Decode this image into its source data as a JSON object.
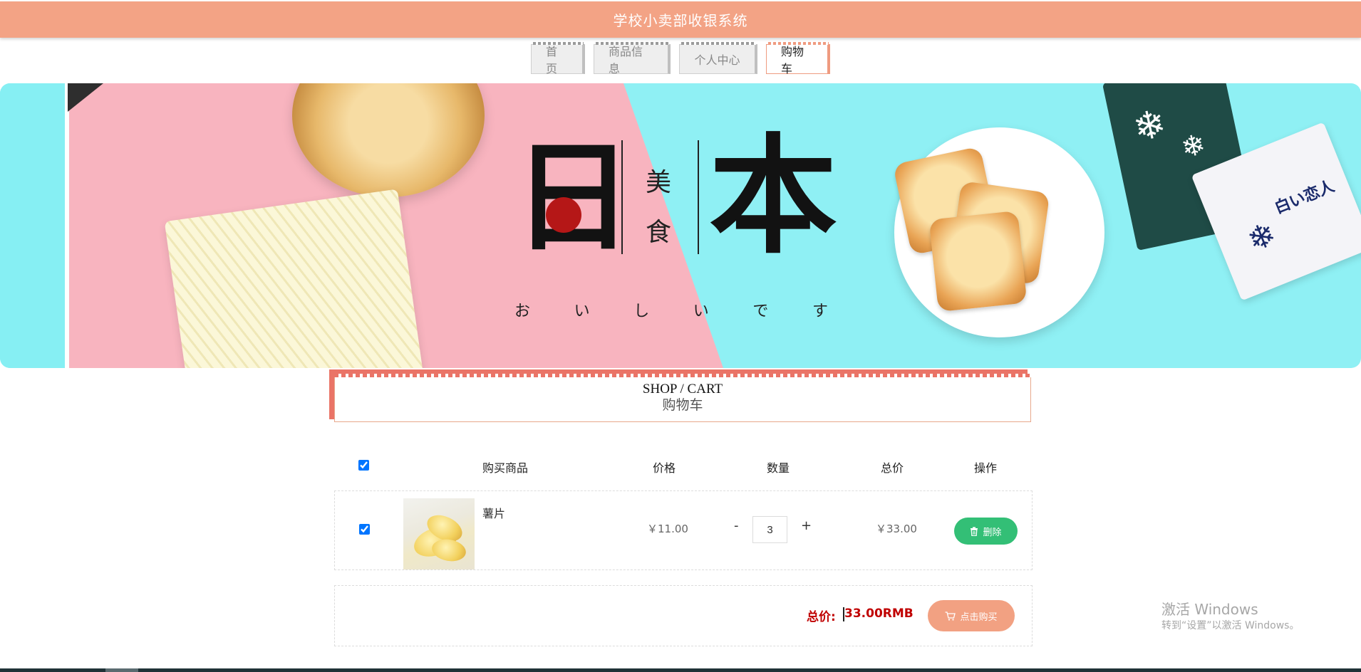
{
  "header": {
    "title": "学校小卖部收银系统",
    "bg_color": "#f3a385"
  },
  "nav": {
    "tabs": [
      {
        "label": "首页",
        "active": false
      },
      {
        "label": "商品信息",
        "active": false
      },
      {
        "label": "个人中心",
        "active": false
      },
      {
        "label": "购物车",
        "active": true
      }
    ]
  },
  "banner": {
    "logo_ri": "日",
    "logo_mei": "美",
    "logo_shi": "食",
    "logo_ben": "本",
    "logo_kana": [
      "お",
      "い",
      "し",
      "い",
      "で",
      "す"
    ],
    "package_text": "白い恋人"
  },
  "section": {
    "title_en": "SHOP / CART",
    "title_cn": "购物车",
    "accent_color": "#ea7467"
  },
  "cart": {
    "headers": {
      "product": "购买商品",
      "price": "价格",
      "quantity": "数量",
      "total": "总价",
      "action": "操作"
    },
    "select_all_checked": true,
    "items": [
      {
        "checked": true,
        "name": "薯片",
        "price": "￥11.00",
        "quantity": "3",
        "total": "￥33.00",
        "minus_label": "-",
        "plus_label": "+",
        "delete_label": "删除",
        "delete_icon": "trash-icon",
        "image_icon": "potato-chips-image"
      }
    ],
    "delete_color": "#33bf76"
  },
  "summary": {
    "label": "总价:",
    "value": "33.00RMB",
    "buy_label": "点击购买",
    "buy_icon": "cart-icon",
    "buy_color": "#f2a182",
    "value_color": "#c00000"
  },
  "watermark": {
    "line1": "激活 Windows",
    "line2": "转到“设置”以激活 Windows。"
  }
}
